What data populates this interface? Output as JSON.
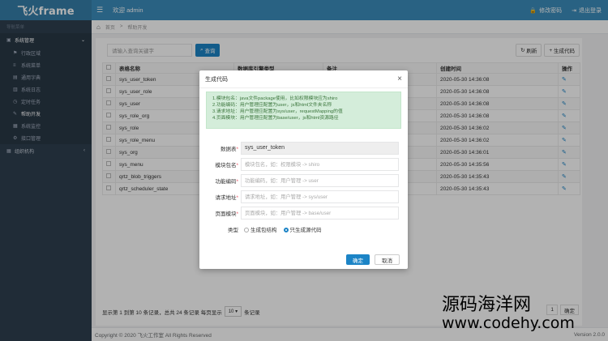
{
  "app": {
    "logo": "飞火frame",
    "welcome": "欢迎 admin"
  },
  "topbar": {
    "change_pwd": "修改密码",
    "logout": "退出登录"
  },
  "sidebar": {
    "section_label": "导航菜单",
    "groups": [
      {
        "label": "系统管理",
        "expanded": true,
        "items": [
          {
            "label": "行政区域"
          },
          {
            "label": "系统菜单"
          },
          {
            "label": "通用字典"
          },
          {
            "label": "系统日志"
          },
          {
            "label": "定时任务"
          },
          {
            "label": "帮助开发",
            "active": true
          },
          {
            "label": "系统监控"
          },
          {
            "label": "接口管理"
          }
        ]
      },
      {
        "label": "组织机构",
        "expanded": false
      }
    ]
  },
  "breadcrumb": {
    "home": "首页",
    "current": "帮助开发"
  },
  "search": {
    "placeholder": "请输入查询关键字",
    "button": "查询"
  },
  "actions": {
    "refresh": "刷新",
    "generate": "生成代码"
  },
  "table": {
    "headers": [
      "表格名称",
      "数据库引擎类型",
      "备注",
      "创建时间",
      "操作"
    ],
    "rows": [
      {
        "name": "sys_user_token",
        "time": "2020-05-30 14:36:08"
      },
      {
        "name": "sys_user_role",
        "time": "2020-05-30 14:36:08"
      },
      {
        "name": "sys_user",
        "time": "2020-05-30 14:36:08"
      },
      {
        "name": "sys_role_org",
        "time": "2020-05-30 14:36:08"
      },
      {
        "name": "sys_role",
        "time": "2020-05-30 14:36:02"
      },
      {
        "name": "sys_role_menu",
        "time": "2020-05-30 14:36:02"
      },
      {
        "name": "sys_org",
        "time": "2020-05-30 14:36:01"
      },
      {
        "name": "sys_menu",
        "time": "2020-05-30 14:35:56"
      },
      {
        "name": "qrtz_blob_triggers",
        "time": "2020-05-30 14:35:43"
      },
      {
        "name": "qrtz_scheduler_state",
        "time": "2020-05-30 14:35:43"
      }
    ]
  },
  "pager": {
    "info_prefix": "显示第 1 到第 10 条记录，总共 24 条记录 每页显示",
    "page_size": "10",
    "info_suffix": "条记录",
    "current_page": "1",
    "confirm": "确定"
  },
  "footer": {
    "copyright": "Copyright © 2020 飞火工作室 All Rights Reserved",
    "version": "Version 2.0.0"
  },
  "modal": {
    "title": "生成代码",
    "tips": [
      "1.模块包名：java文件package使用，比如权限模块应为shiro",
      "2.功能编码：用户管理应配置为user，js和html文件夹名称",
      "3.请求地址：用户管理应配置为sys/user，requestMapping的值",
      "4.页面模块：用户管理应配置为base/user，js和html资源路径"
    ],
    "fields": {
      "table_label": "数据表",
      "table_value": "sys_user_token",
      "pkg_label": "模块包名",
      "pkg_placeholder": "模块包名，如：权限模块 -> shiro",
      "code_label": "功能编码",
      "code_placeholder": "功能编码，如：用户管理 -> user",
      "url_label": "请求地址",
      "url_placeholder": "请求地址，如：用户管理 -> sys/user",
      "page_label": "页面模块",
      "page_placeholder": "页面模块，如：用户管理 -> base/user",
      "type_label": "类型",
      "type_opt1": "生成包结构",
      "type_opt2": "只生成源代码"
    },
    "ok": "确定",
    "cancel": "取消"
  },
  "watermark": {
    "line1": "源码海洋网",
    "line2": "www.codehy.com"
  }
}
